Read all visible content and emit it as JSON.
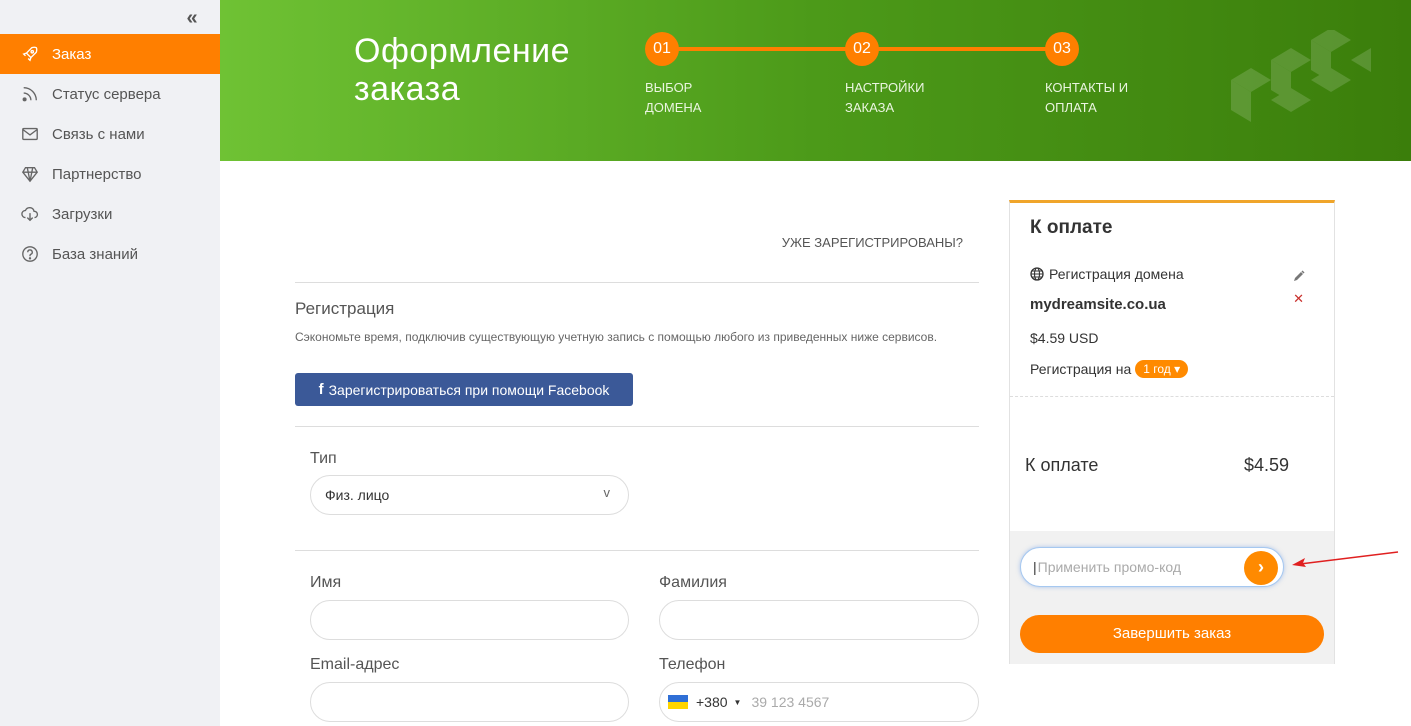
{
  "sidebar": {
    "items": [
      {
        "label": "Заказ",
        "icon": "rocket-icon",
        "active": true
      },
      {
        "label": "Статус сервера",
        "icon": "rss-icon"
      },
      {
        "label": "Связь с нами",
        "icon": "envelope-icon"
      },
      {
        "label": "Партнерство",
        "icon": "diamond-icon"
      },
      {
        "label": "Загрузки",
        "icon": "cloud-download-icon"
      },
      {
        "label": "База знаний",
        "icon": "question-circle-icon"
      }
    ]
  },
  "banner": {
    "title": "Оформление заказа",
    "steps": [
      {
        "number": "01",
        "label": "ВЫБОР ДОМЕНА"
      },
      {
        "number": "02",
        "label": "НАСТРОЙКИ ЗАКАЗА"
      },
      {
        "number": "03",
        "label": "КОНТАКТЫ И ОПЛАТА"
      }
    ]
  },
  "form": {
    "already_registered": "УЖЕ ЗАРЕГИСТРИРОВАНЫ?",
    "registration_title": "Регистрация",
    "registration_desc": "Сэкономьте время, подключив существующую учетную запись с помощью любого из приведенных ниже сервисов.",
    "facebook_button": "Зарегистрироваться при помощи Facebook",
    "type_label": "Тип",
    "type_value": "Физ. лицо",
    "first_name_label": "Имя",
    "last_name_label": "Фамилия",
    "email_label": "Email-адрес",
    "phone_label": "Телефон",
    "phone_code": "+380",
    "phone_placeholder": "39 123 4567"
  },
  "summary": {
    "title": "К оплате",
    "item_label": "Регистрация домена",
    "domain": "mydreamsite.co.ua",
    "price": "$4.59 USD",
    "period_label": "Регистрация на",
    "period_value": "1 год",
    "total_label": "К оплате",
    "total_value": "$4.59",
    "promo_placeholder": "Применить промо-код",
    "finish_button": "Завершить заказ"
  },
  "colors": {
    "accent": "#ff7f00",
    "banner_green": "#4c9a19",
    "facebook": "#3b5998"
  }
}
